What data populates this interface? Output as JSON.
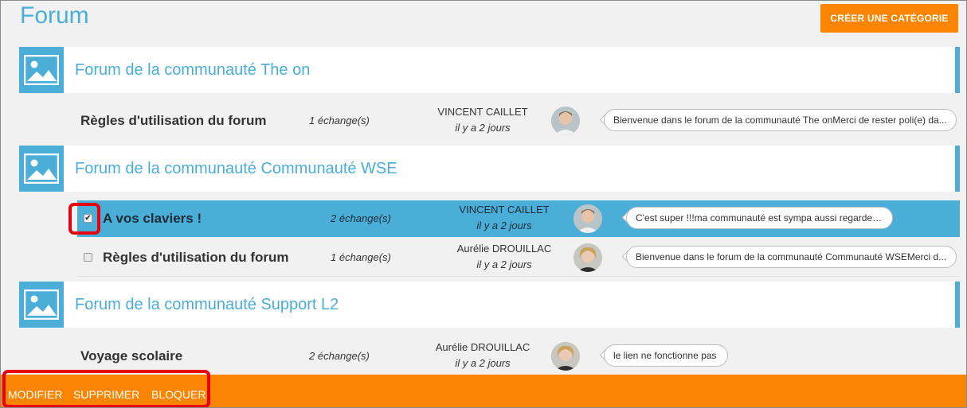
{
  "page": {
    "title": "Forum",
    "create_category_label": "CRÉER UNE CATÉGORIE"
  },
  "categories": [
    {
      "title": "Forum de la communauté The on",
      "topics": [
        {
          "subject": "Règles d'utilisation du forum",
          "count": "1 échange(s)",
          "author": "VINCENT CAILLET",
          "when": "il y a 2 jours",
          "last_message": "Bienvenue dans le forum de la communauté The onMerci de rester poli(e) da..."
        }
      ]
    },
    {
      "title": "Forum de la communauté Communauté WSE",
      "topics": [
        {
          "subject": "A vos claviers !",
          "count": "2 échange(s)",
          "author": "VINCENT CAILLET",
          "when": "il y a 2 jours",
          "last_message": "C'est super !!!ma communauté est sympa aussi regarde ici",
          "checked": true,
          "selected": true
        },
        {
          "subject": "Règles d'utilisation du forum",
          "count": "1 échange(s)",
          "author": "Aurélie DROUILLAC",
          "when": "il y a 2 jours",
          "last_message": "Bienvenue dans le forum de la communauté Communauté WSEMerci d...",
          "checked": false
        }
      ]
    },
    {
      "title": "Forum de la communauté Support L2",
      "topics": [
        {
          "subject": "Voyage scolaire",
          "count": "2 échange(s)",
          "author": "Aurélie DROUILLAC",
          "when": "il y a 2 jours",
          "last_message": "le lien ne fonctionne pas"
        }
      ]
    }
  ],
  "actions": {
    "modify": "MODIFIER",
    "delete": "SUPPRIMER",
    "block": "BLOQUER"
  },
  "colors": {
    "accent": "#4aaed9",
    "orange": "#fb8500",
    "highlight": "#e8000f"
  },
  "icons": {
    "category_thumb": "image-placeholder-icon",
    "avatar": "user-avatar"
  }
}
